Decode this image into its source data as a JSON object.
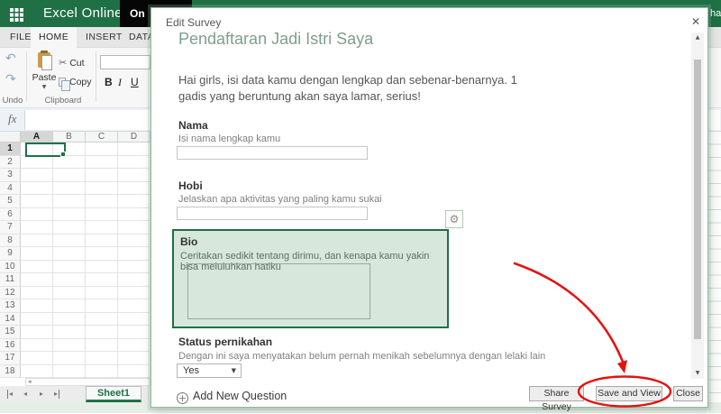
{
  "app": {
    "brand": "Excel Online",
    "header_breadcrumb_partial": "On",
    "header_right_partial": "ha",
    "tabs": [
      "FILE",
      "HOME",
      "INSERT",
      "DATA"
    ],
    "active_tab": "HOME",
    "ribbon": {
      "undo_group_label": "Undo",
      "clipboard_group_label": "Clipboard",
      "paste_label": "Paste",
      "cut_label": "Cut",
      "copy_label": "Copy",
      "bold_label": "B",
      "italic_label": "I",
      "underline_label": "U"
    },
    "formula_bar_fx": "fx",
    "grid": {
      "columns": [
        "A",
        "B",
        "C",
        "D"
      ],
      "selected_column": "A",
      "selected_row": 1,
      "visible_rows": 19,
      "selected_cell": "A1"
    },
    "sheet_tab": "Sheet1"
  },
  "dialog": {
    "title": "Edit Survey",
    "survey": {
      "title": "Pendaftaran Jadi Istri Saya",
      "description": "Hai girls, isi data kamu dengan lengkap dan sebenar-benarnya. 1 gadis yang beruntung akan saya lamar, serius!",
      "questions": [
        {
          "label": "Nama",
          "hint": "Isi nama lengkap kamu",
          "type": "text",
          "value": ""
        },
        {
          "label": "Hobi",
          "hint": "Jelaskan apa aktivitas yang paling kamu sukai",
          "type": "text",
          "value": ""
        },
        {
          "label": "Bio",
          "hint": "Ceritakan sedikit tentang dirimu, dan kenapa kamu yakin bisa meluluhkan hatiku",
          "type": "textarea",
          "value": "",
          "selected": true
        },
        {
          "label": "Status pernikahan",
          "hint": "Dengan ini saya menyatakan belum pernah menikah sebelumnya dengan lelaki lain",
          "type": "dropdown",
          "value": "Yes"
        }
      ],
      "add_new_question_label": "Add New Question"
    },
    "footer": {
      "share_label": "Share Survey",
      "save_label": "Save and View",
      "close_label": "Close"
    }
  },
  "icons": {
    "close": "✕",
    "scroll_up": "▲",
    "scroll_down": "▼",
    "dropdown_caret": "▼",
    "paste_caret": "▼",
    "cut": "✂",
    "undo": "↶",
    "redo": "↷",
    "gear": "⚙",
    "add_plus": "+",
    "nav_prev": "◂",
    "nav_next": "▸",
    "hscroll_left": "◂"
  },
  "annotation": {
    "color": "#e51212",
    "circled_button": "Save and View"
  },
  "colors": {
    "excel_green": "#1f7145",
    "cell_selection_green": "#1f7246",
    "survey_title_green": "#7e9f8f",
    "bio_highlight_bg": "#d8e7db",
    "bio_highlight_border": "#1e7145",
    "annotation_red": "#e51212"
  }
}
